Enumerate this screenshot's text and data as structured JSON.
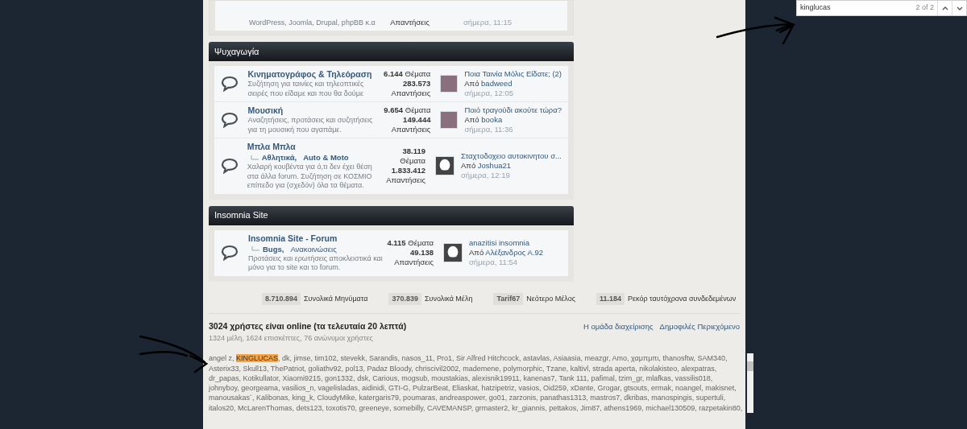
{
  "find_bar": {
    "query": "kinglucas",
    "count": "2 of 2"
  },
  "partial_forum": {
    "description": "WordPress, Joomla, Drupal, phpBB κ.α",
    "replies_label": "Απαντήσεις",
    "last_post_time": "σήμερα, 11:15"
  },
  "sections": [
    {
      "title": "Ψυχαγωγία",
      "forums": [
        {
          "title": "Κινηματογράφος & Τηλεόραση",
          "description": "Συζήτηση για ταινίες και τηλεοπτικές σειρές που είδαμε και που θα δούμε",
          "topics": "6.144",
          "topics_label": "Θέματα",
          "replies": "283.573",
          "replies_label": "Απαντήσεις",
          "avatar": {
            "kind": "photo"
          },
          "last_post": {
            "title": "Ποια Ταινία Μόλις Είδατε; (2)",
            "by": "Από",
            "author": "badweed",
            "time": "σήμερα, 12:05"
          }
        },
        {
          "title": "Μουσική",
          "description": "Αναζητήσεις, προτάσεις και συζητήσεις για τη μουσική που αγαπάμε.",
          "topics": "9.654",
          "topics_label": "Θέματα",
          "replies": "149.444",
          "replies_label": "Απαντήσεις",
          "avatar": {
            "kind": "photo"
          },
          "last_post": {
            "title": "Ποιό τραγούδι ακούτε τώρα?",
            "by": "Από",
            "author": "booka",
            "time": "σήμερα, 11:36"
          }
        },
        {
          "title": "Μπλα Μπλα",
          "subforums": [
            {
              "name": "Αθλητικά,",
              "unread": true
            },
            {
              "name": "Auto & Moto",
              "unread": true
            }
          ],
          "description": "Χαλαρή κουβέντα για ό,τι δεν έχει θέση στα άλλα forum. Συζήτηση σε ΚΟΣΜΙΟ επίπεδο για (σχεδόν) όλα τα θέματα.",
          "topics": "38.119",
          "topics_label": "Θέματα",
          "replies": "1.833.412",
          "replies_label": "Απαντήσεις",
          "avatar": {
            "kind": "silhouette"
          },
          "last_post": {
            "title": "Σταχτοδοχειο αυτοκινητου σ...",
            "by": "Από",
            "author": "Joshua21",
            "time": "σήμερα, 12:19"
          }
        }
      ]
    },
    {
      "title": "Insomnia Site",
      "forums": [
        {
          "title": "Insomnia Site - Forum",
          "subforums": [
            {
              "name": "Bugs,",
              "unread": true
            },
            {
              "name": "Ανακοινώσεις",
              "unread": false
            }
          ],
          "description": "Προτάσεις και ερωτήσεις αποκλειστικά και μόνο για το site και το forum.",
          "topics": "4.115",
          "topics_label": "Θέματα",
          "replies": "49.138",
          "replies_label": "Απαντήσεις",
          "avatar": {
            "kind": "silhouette"
          },
          "last_post": {
            "title": "anazitisi insomnia",
            "by": "Από",
            "author": "Αλέξανδρος Α.92",
            "time": "σήμερα, 11:54"
          }
        }
      ]
    }
  ],
  "stats": [
    {
      "value": "8.710.894",
      "label": "Συνολικά Μηνύματα"
    },
    {
      "value": "370.839",
      "label": "Συνολικά Μέλη"
    },
    {
      "value": "Tarif67",
      "label": "Νεότερο Μέλος"
    },
    {
      "value": "11.184",
      "label": "Ρεκόρ ταυτόχρονα συνδεδεμένων"
    }
  ],
  "online": {
    "title": "3024 χρήστες είναι online (τα τελευταία 20 λεπτά)",
    "summary": "1324 μέλη, 1624 επισκέπτες, 76 ανώνυμοι χρήστες",
    "links": [
      "Η ομάδα διαχείρισης",
      "Δημοφιλές Περιεχόμενο"
    ],
    "lines": [
      [
        {
          "text": "angel z, ",
          "highlighted": false
        },
        {
          "text": "KINGLUCAS",
          "highlighted": true
        },
        {
          "text": ", dk, jimse, tim102, stevekk, Sarandis, nasos_11, Pro1, Sir Alfred Hitchcock, astavlas, Asiaasia, meazgr, Amo, χαμπμπι, thanosftw, SAM340,",
          "highlighted": false
        }
      ],
      [
        {
          "text": "Asterix33, Skull13, ThePatriot, goliathv92, pol13, Padaz Bloody, chriscivil2002, mademene, polymorphic, Tzane, kaltivl, strada aperta, nikolakisteo, alexpatras,",
          "highlighted": false
        }
      ],
      [
        {
          "text": "dr_papas, Kotikullator, Xiaomi9215, gon1332, dsk, Carious, mogsub, moustakias, alexisnik19911, kanenas7, Tank 111, pafimal, tzim_gr, mlafkas, vassilis018,",
          "highlighted": false
        }
      ],
      [
        {
          "text": "johnyboy, georgeama, vasilios_n, vagelisladas, aidinidi, GTI-G, PulzarBeat, Eliaskat, hatzipetriz, vasios, Oid259, xDante, Grogar, gtsouts, ermak, noangel, makisnet,",
          "highlighted": false
        }
      ],
      [
        {
          "text": "manousakas`, Kalibonas, king_k, CloudyMike, katergaris79, poumaras, andreaspower, go01, zarzonis, panathas1313, mastros7, dkribas, manospingis, supertuli,",
          "highlighted": false
        }
      ],
      [
        {
          "text": "italos20, McLarenThomas, dets123, toxotis70, greeneye, somebilly, CAVEMANSP, grmaster2, kr_giannis, pettakos, Jim87, athens1969, michael130509, razpetakin80,",
          "highlighted": false
        }
      ]
    ]
  }
}
